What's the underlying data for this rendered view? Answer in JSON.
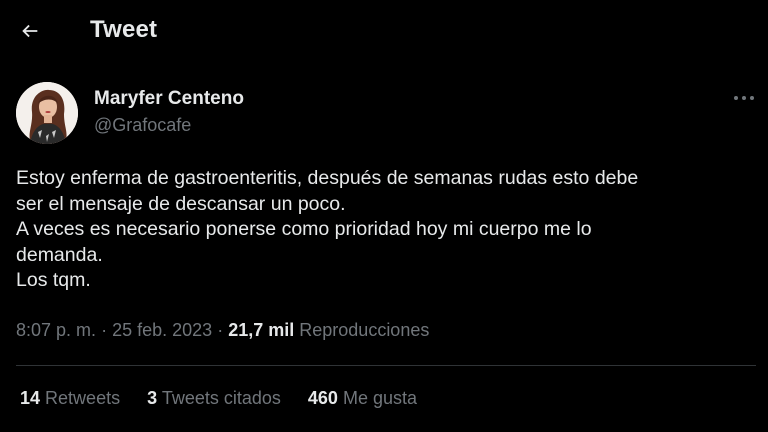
{
  "header": {
    "title": "Tweet",
    "back_icon": "arrow-left-icon"
  },
  "author": {
    "display_name": "Maryfer Centeno",
    "handle": "@Grafocafe",
    "avatar": "avatar"
  },
  "more_icon": "more-horizontal-icon",
  "tweet": {
    "lines": [
      "Estoy enferma de gastroenteritis, después de semanas rudas esto debe",
      "ser el mensaje de descansar un poco.",
      "A veces es necesario ponerse como prioridad hoy mi cuerpo me lo",
      "demanda.",
      "Los tqm."
    ]
  },
  "meta": {
    "time": "8:07 p. m.",
    "separator": "·",
    "date": "25 feb. 2023",
    "views_count": "21,7 mil",
    "views_label": "Reproducciones"
  },
  "stats": {
    "retweets_count": "14",
    "retweets_label": "Retweets",
    "quotes_count": "3",
    "quotes_label": "Tweets citados",
    "likes_count": "460",
    "likes_label": "Me gusta"
  },
  "colors": {
    "background": "#000000",
    "text_primary": "#e7e9ea",
    "text_secondary": "#71767b",
    "divider": "#2f3336"
  }
}
